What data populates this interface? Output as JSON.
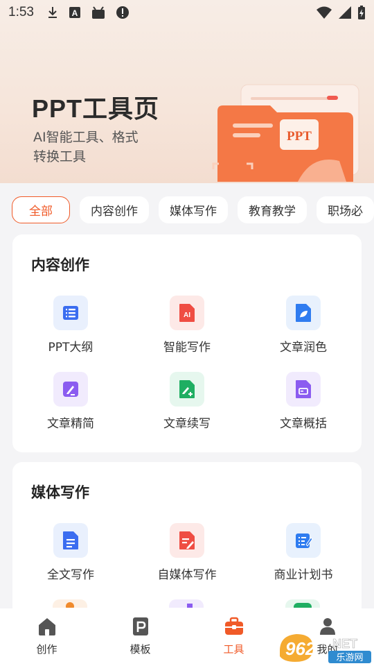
{
  "status_bar": {
    "time": "1:53"
  },
  "hero": {
    "title": "PPT工具页",
    "subtitle_line1": "AI智能工具、格式",
    "subtitle_line2": "转换工具",
    "art_text": "PPT"
  },
  "tabs": [
    {
      "label": "全部",
      "active": true
    },
    {
      "label": "内容创作"
    },
    {
      "label": "媒体写作"
    },
    {
      "label": "教育教学"
    },
    {
      "label": "职场必"
    }
  ],
  "sections": [
    {
      "title": "内容创作",
      "tools": [
        {
          "label": "PPT大纲",
          "icon": "outline-list-icon",
          "bg": "#e9f0fd",
          "fg": "#3b6df0"
        },
        {
          "label": "智能写作",
          "icon": "ai-doc-icon",
          "bg": "#fde9e7",
          "fg": "#ef4d43"
        },
        {
          "label": "文章润色",
          "icon": "leaf-doc-icon",
          "bg": "#e8f1fd",
          "fg": "#2f7cf0"
        },
        {
          "label": "文章精简",
          "icon": "edit-doc-icon",
          "bg": "#f1ebfd",
          "fg": "#8b5cf0"
        },
        {
          "label": "文章续写",
          "icon": "pen-plus-doc-icon",
          "bg": "#e6f7ee",
          "fg": "#1fae62"
        },
        {
          "label": "文章概括",
          "icon": "summary-doc-icon",
          "bg": "#f1ebfd",
          "fg": "#8b5cf0"
        }
      ]
    },
    {
      "title": "媒体写作",
      "tools": [
        {
          "label": "全文写作",
          "icon": "full-doc-icon",
          "bg": "#e9f0fd",
          "fg": "#3b6df0"
        },
        {
          "label": "自媒体写作",
          "icon": "media-doc-icon",
          "bg": "#fde9e7",
          "fg": "#ef4d43"
        },
        {
          "label": "商业计划书",
          "icon": "plan-doc-icon",
          "bg": "#e8f1fd",
          "fg": "#2f7cf0"
        }
      ]
    }
  ],
  "bottom_nav": [
    {
      "label": "创作",
      "icon": "home-icon"
    },
    {
      "label": "模板",
      "icon": "template-icon"
    },
    {
      "label": "工具",
      "icon": "toolbox-icon",
      "active": true
    },
    {
      "label": "我的",
      "icon": "profile-icon"
    }
  ],
  "watermark": {
    "brand": "962",
    "suffix": "NET",
    "sub": "乐游网"
  },
  "colors": {
    "accent": "#f05a28"
  }
}
